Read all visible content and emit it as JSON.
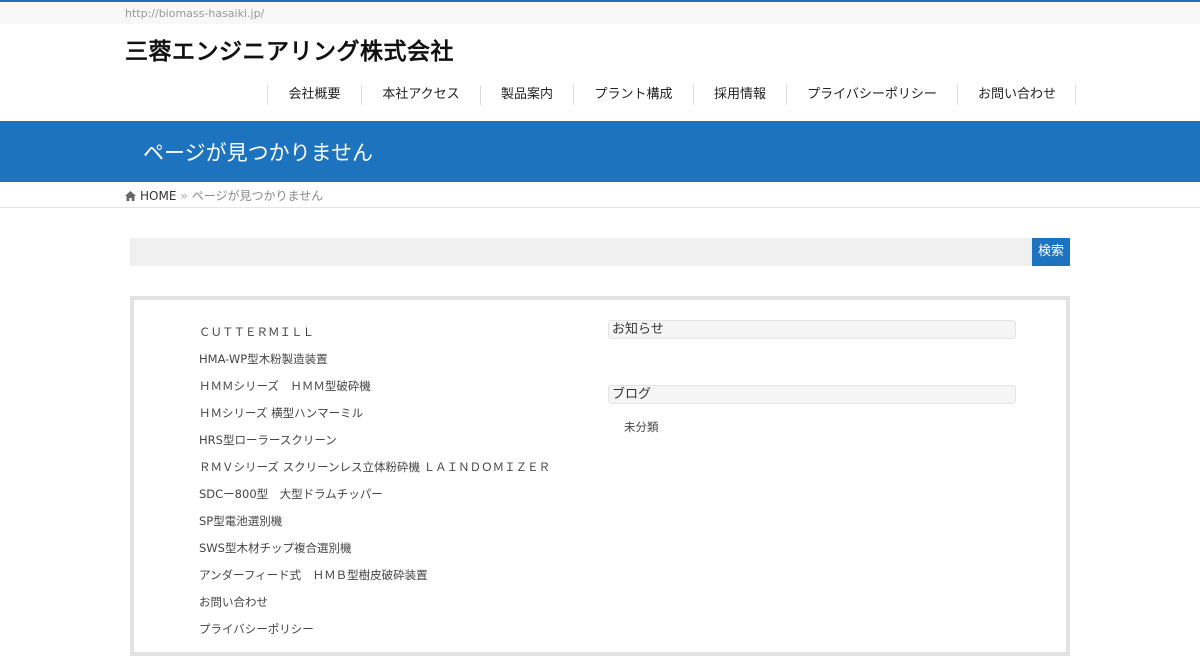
{
  "header": {
    "url": "http://biomass-hasaiki.jp/",
    "site_title": "三蓉エンジニアリング株式会社"
  },
  "nav": {
    "items": [
      "会社概要",
      "本社アクセス",
      "製品案内",
      "プラント構成",
      "採用情報",
      "プライバシーポリシー",
      "お問い合わせ"
    ]
  },
  "banner": {
    "title": "ページが見つかりません"
  },
  "breadcrumb": {
    "home": "HOME",
    "separator": "»",
    "current": "ページが見つかりません"
  },
  "search": {
    "placeholder": "",
    "button_label": "検索"
  },
  "pages": {
    "items": [
      "ＣＵＴＴＥＲＭＩＬＬ",
      "HMA-WP型木粉製造装置",
      "ＨＭＭシリーズ　ＨＭＭ型破砕機",
      "ＨＭシリーズ 横型ハンマーミル",
      "HRS型ローラースクリーン",
      "ＲＭＶシリーズ スクリーンレス立体粉砕機 ＬＡＩＮＤＯＭＩＺＥＲ",
      "SDCー800型　大型ドラムチッパー",
      "SP型電池選別機",
      "SWS型木材チップ複合選別機",
      "アンダーフィード式　ＨＭＢ型樹皮破砕装置",
      "お問い合わせ",
      "プライバシーポリシー"
    ]
  },
  "widgets": {
    "news": {
      "title": "お知らせ"
    },
    "blog": {
      "title": "ブログ",
      "items": [
        "未分類"
      ]
    }
  },
  "colors": {
    "accent": "#1e73be",
    "banner_text": "#ffffff"
  }
}
